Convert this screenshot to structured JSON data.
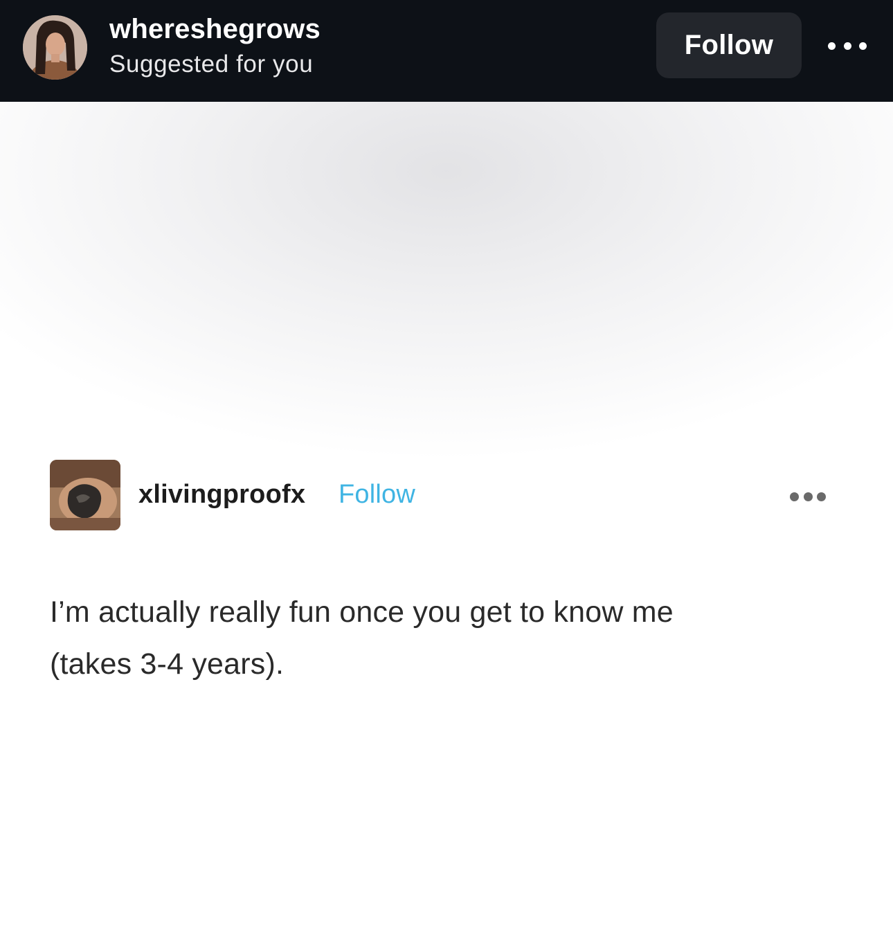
{
  "header": {
    "avatar_icon": "user-avatar-photo",
    "username": "whereshegrows",
    "subtitle": "Suggested for you",
    "follow_label": "Follow",
    "more_icon": "more-horizontal-icon"
  },
  "post": {
    "author_avatar_icon": "author-avatar-photo",
    "author": "xlivingproofx",
    "follow_label": "Follow",
    "follow_color": "#3fb4e3",
    "more_icon": "more-horizontal-icon",
    "text_lines": [
      "I’m actually really fun once you get to know me",
      "(takes 3-4 years)."
    ]
  }
}
